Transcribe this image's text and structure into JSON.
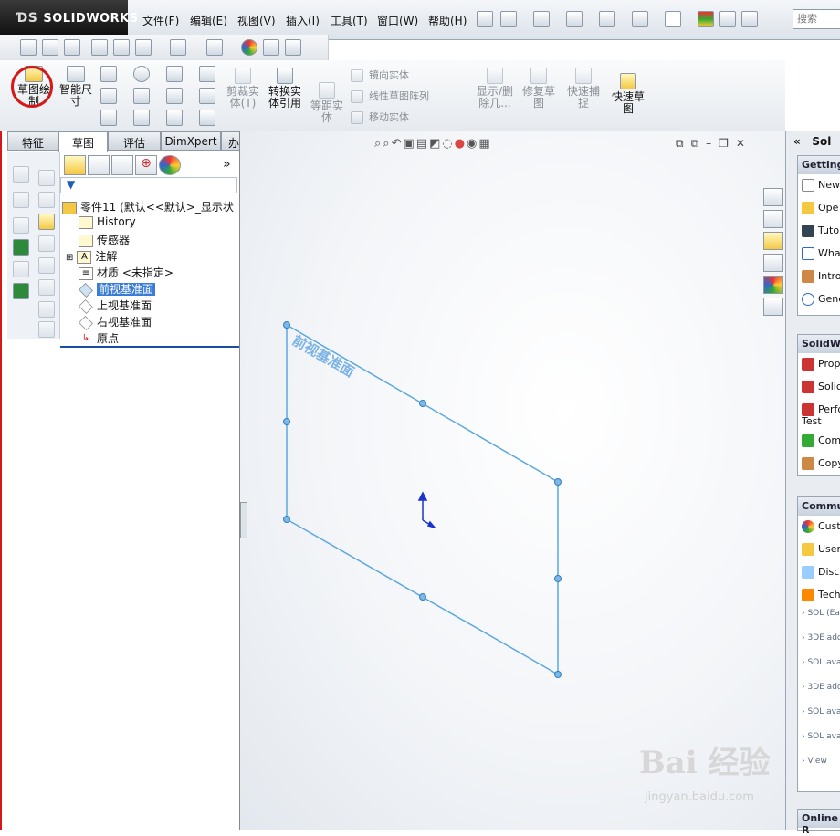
{
  "app": {
    "name": "SOLIDWORKS"
  },
  "menu": [
    "文件(F)",
    "编辑(E)",
    "视图(V)",
    "插入(I)",
    "工具(T)",
    "窗口(W)",
    "帮助(H)"
  ],
  "search": {
    "placeholder": "搜索"
  },
  "commands": {
    "sketch": "草图绘制",
    "smart_dim": "智能尺寸",
    "trim": "剪裁实体(T)",
    "convert": "转换实体引用",
    "offset": "等距实体",
    "mirror": "镜向实体",
    "linear_pattern": "线性草图阵列",
    "move": "移动实体",
    "show_delete": "显示/删除几...",
    "repair": "修复草图",
    "quick_snaps": "快速捕捉",
    "rapid_sketch": "快速草图"
  },
  "tabs": [
    "特征",
    "草图",
    "评估",
    "DimXpert",
    "办公室产品"
  ],
  "active_tab": 1,
  "tree": {
    "root": "零件11 (默认<<默认>_显示状",
    "items": [
      {
        "label": "History",
        "icon": "history-icon"
      },
      {
        "label": "传感器",
        "icon": "sensor-icon"
      },
      {
        "label": "注解",
        "icon": "annotation-icon"
      },
      {
        "label": "材质 <未指定>",
        "icon": "material-icon"
      },
      {
        "label": "前视基准面",
        "icon": "plane-icon",
        "selected": true
      },
      {
        "label": "上视基准面",
        "icon": "plane-icon"
      },
      {
        "label": "右视基准面",
        "icon": "plane-icon"
      },
      {
        "label": "原点",
        "icon": "origin-icon"
      }
    ]
  },
  "viewport": {
    "plane_label": "前视基准面"
  },
  "right_pane": {
    "title": "Sol",
    "getting_started": {
      "header": "Getting",
      "items": [
        "New",
        "Ope",
        "Tuto",
        "Wha",
        "Intro",
        "Gene"
      ]
    },
    "solidworks": {
      "header": "SolidWo",
      "items": [
        "Prop",
        "Solic",
        "Perfo Test",
        "Com",
        "Copy"
      ]
    },
    "community": {
      "header": "Commu",
      "items": [
        "Cust",
        "User",
        "Disc",
        "Tech"
      ]
    },
    "news": [
      "SOL (Ear",
      "3DE add",
      "SOL ava",
      "3DE add",
      "SOL ava",
      "SOL ava"
    ],
    "view_more": "View",
    "online": "Online R"
  },
  "watermark": {
    "brand": "Bai 经验",
    "url": "jingyan.baidu.com"
  }
}
